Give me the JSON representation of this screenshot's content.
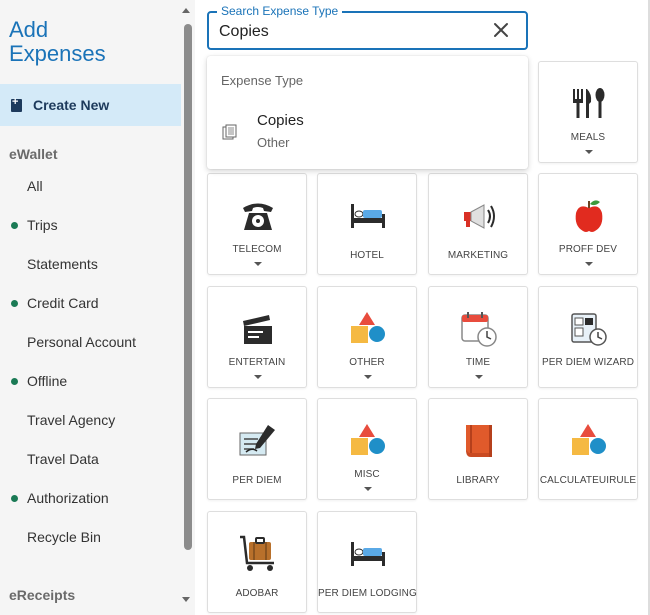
{
  "sidebar": {
    "title_line1": "Add",
    "title_line2": "Expenses",
    "create_new": "Create New",
    "ewallet_heading": "eWallet",
    "items": [
      {
        "label": "All",
        "dot": false
      },
      {
        "label": "Trips",
        "dot": true
      },
      {
        "label": "Statements",
        "dot": false
      },
      {
        "label": "Credit Card",
        "dot": true
      },
      {
        "label": "Personal Account",
        "dot": false
      },
      {
        "label": "Offline",
        "dot": true
      },
      {
        "label": "Travel Agency",
        "dot": false
      },
      {
        "label": "Travel Data",
        "dot": false
      },
      {
        "label": "Authorization",
        "dot": true
      },
      {
        "label": "Recycle Bin",
        "dot": false
      }
    ],
    "ereceipts_heading": "eReceipts"
  },
  "search": {
    "legend": "Search Expense Type",
    "value": "Copies"
  },
  "dropdown": {
    "heading": "Expense Type",
    "results": [
      {
        "title": "Copies",
        "subtitle": "Other",
        "icon": "copies-icon"
      }
    ]
  },
  "tiles": [
    {
      "label": "MEALS",
      "icon": "meals-icon",
      "caret": true
    },
    {
      "label": "TELECOM",
      "icon": "telephone-icon",
      "caret": true
    },
    {
      "label": "HOTEL",
      "icon": "bed-icon",
      "caret": false
    },
    {
      "label": "MARKETING",
      "icon": "megaphone-icon",
      "caret": false
    },
    {
      "label": "PROFF DEV",
      "icon": "apple-icon",
      "caret": true
    },
    {
      "label": "ENTERTAIN",
      "icon": "clapperboard-icon",
      "caret": true
    },
    {
      "label": "OTHER",
      "icon": "shapes-icon",
      "caret": true
    },
    {
      "label": "TIME",
      "icon": "calendar-clock-icon",
      "caret": true
    },
    {
      "label": "PER DIEM WIZARD",
      "icon": "per-diem-wizard-icon",
      "caret": false
    },
    {
      "label": "PER DIEM",
      "icon": "ticket-pen-icon",
      "caret": false
    },
    {
      "label": "MISC",
      "icon": "shapes-icon",
      "caret": true
    },
    {
      "label": "LIBRARY",
      "icon": "book-icon",
      "caret": false
    },
    {
      "label": "CALCULATEUIRULE",
      "icon": "shapes-icon",
      "caret": false
    },
    {
      "label": "ADOBAR",
      "icon": "luggage-cart-icon",
      "caret": false
    },
    {
      "label": "PER DIEM LODGING",
      "icon": "bed-icon",
      "caret": false
    }
  ],
  "colors": {
    "accent": "#1a73b8",
    "nav_dot": "#1a7a55",
    "create_new_bg": "#d4eaf8",
    "sidebar_bg": "#f5f5f5"
  }
}
